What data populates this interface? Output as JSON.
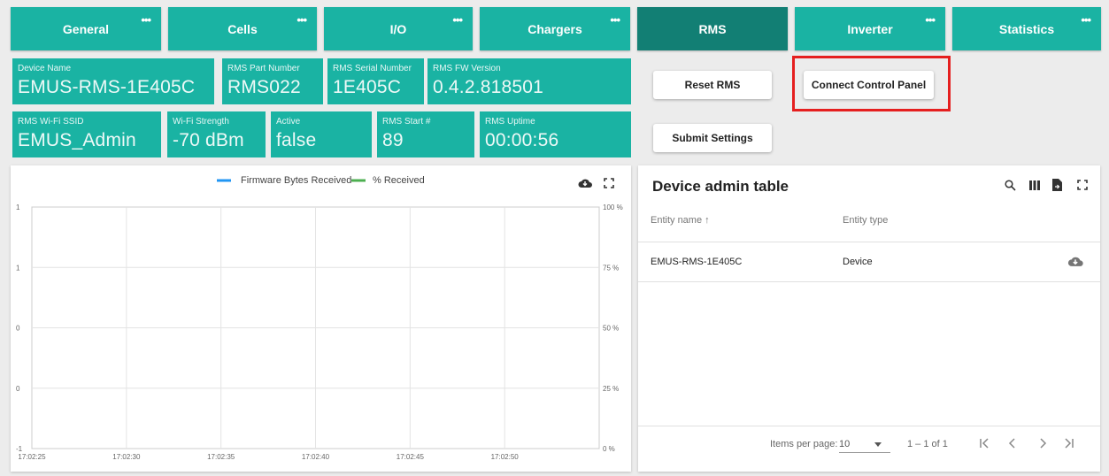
{
  "tabs": [
    {
      "label": "General",
      "dots": "•••"
    },
    {
      "label": "Cells",
      "dots": "•••"
    },
    {
      "label": "I/O",
      "dots": "•••"
    },
    {
      "label": "Chargers",
      "dots": "•••"
    },
    {
      "label": "RMS",
      "dots": ""
    },
    {
      "label": "Inverter",
      "dots": "•••"
    },
    {
      "label": "Statistics",
      "dots": "•••"
    }
  ],
  "tiles": {
    "device_name": {
      "label": "Device Name",
      "value": "EMUS-RMS-1E405C"
    },
    "part_number": {
      "label": "RMS Part Number",
      "value": "RMS022"
    },
    "serial_number": {
      "label": "RMS Serial Number",
      "value": "1E405C"
    },
    "fw_version": {
      "label": "RMS FW Version",
      "value": "0.4.2.818501"
    },
    "wifi_ssid": {
      "label": "RMS Wi-Fi SSID",
      "value": "EMUS_Admin"
    },
    "wifi_strength": {
      "label": "Wi-Fi Strength",
      "value": "-70 dBm"
    },
    "active": {
      "label": "Active",
      "value": "false"
    },
    "start_count": {
      "label": "RMS Start #",
      "value": "89"
    },
    "uptime": {
      "label": "RMS Uptime",
      "value": "00:00:56"
    }
  },
  "buttons": {
    "reset": "Reset RMS",
    "connect": "Connect Control Panel",
    "submit": "Submit Settings"
  },
  "chart_data": {
    "type": "line",
    "series": [
      {
        "name": "Firmware Bytes Received",
        "color": "#2196f3",
        "values": []
      },
      {
        "name": "% Received",
        "color": "#4caf50",
        "values": []
      }
    ],
    "x_ticks": [
      "17:02:25",
      "17:02:30",
      "17:02:35",
      "17:02:40",
      "17:02:45",
      "17:02:50"
    ],
    "y_left_ticks": [
      "1",
      "1",
      "0",
      "0",
      "-1"
    ],
    "y_right_ticks": [
      "100 %",
      "75 %",
      "50 %",
      "25 %",
      "0 %"
    ],
    "grid": true,
    "legend": "top-center"
  },
  "table": {
    "title": "Device admin table",
    "columns": [
      "Entity name ↑",
      "Entity type"
    ],
    "rows": [
      {
        "name": "EMUS-RMS-1E405C",
        "type": "Device"
      }
    ],
    "footer": {
      "items_per_page_label": "Items per page:",
      "items_per_page": "10",
      "range": "1 – 1 of 1"
    }
  },
  "icons": {
    "dots": "more-horiz-icon",
    "download": "cloud-download-icon",
    "fullscreen": "fullscreen-icon",
    "search": "search-icon",
    "columns": "columns-icon",
    "export": "file-export-icon"
  },
  "colors": {
    "tile": "#1ab3a3",
    "tab_active": "#127f74",
    "highlight": "#e51f1f"
  }
}
